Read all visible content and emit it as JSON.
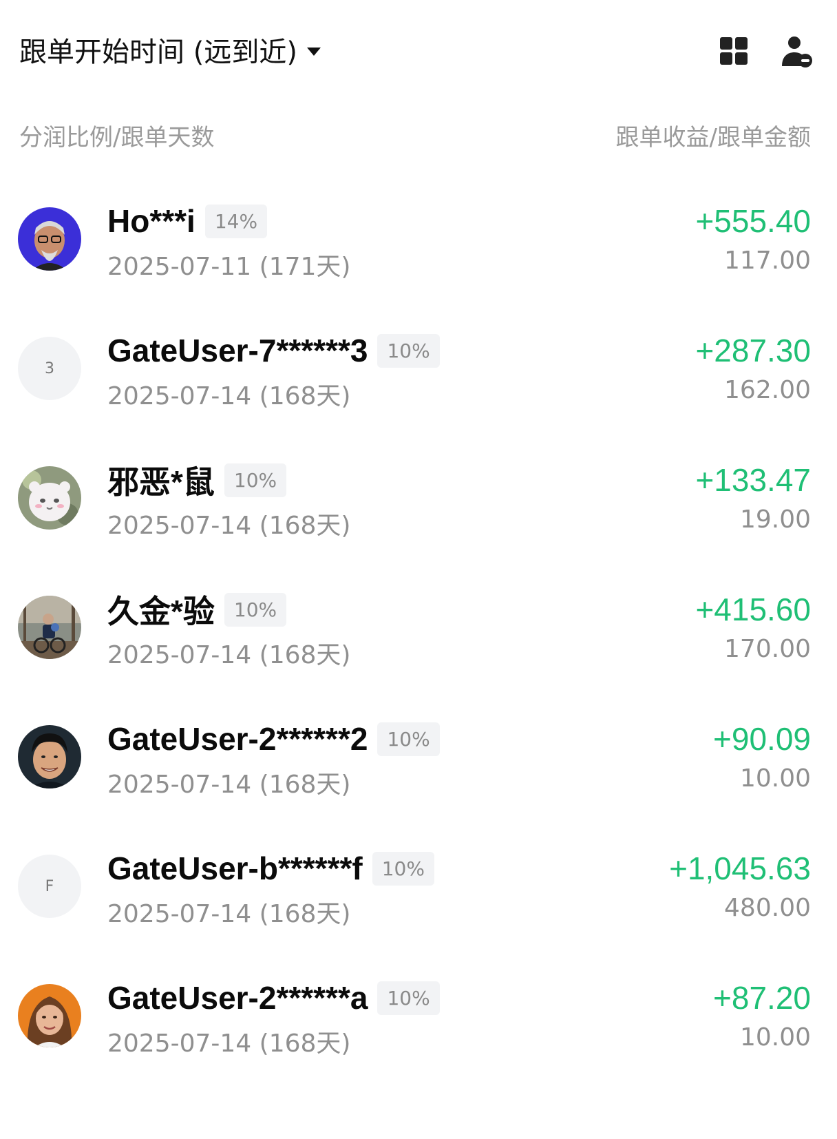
{
  "header": {
    "sort_label": "跟单开始时间 (远到近)",
    "sort_icon": "caret-down-icon",
    "grid_icon": "grid-icon",
    "user_icon": "user-minus-icon"
  },
  "columns": {
    "left": "分润比例/跟单天数",
    "right": "跟单收益/跟单金额"
  },
  "colors": {
    "profit": "#1fbf75",
    "muted": "#8f8f8f",
    "badge_bg": "#f2f3f5"
  },
  "rows": [
    {
      "name": "Ho***i",
      "share": "14%",
      "date": "2025-07-11 (171天)",
      "profit": "+555.40",
      "amount": "117.00",
      "avatar": "photo"
    },
    {
      "name": "GateUser-7******3",
      "share": "10%",
      "date": "2025-07-14 (168天)",
      "profit": "+287.30",
      "amount": "162.00",
      "avatar": "letter",
      "avatar_letter": "3"
    },
    {
      "name": "邪恶*鼠",
      "share": "10%",
      "date": "2025-07-14 (168天)",
      "profit": "+133.47",
      "amount": "19.00",
      "avatar": "photo"
    },
    {
      "name": "久金*验",
      "share": "10%",
      "date": "2025-07-14 (168天)",
      "profit": "+415.60",
      "amount": "170.00",
      "avatar": "photo"
    },
    {
      "name": "GateUser-2******2",
      "share": "10%",
      "date": "2025-07-14 (168天)",
      "profit": "+90.09",
      "amount": "10.00",
      "avatar": "photo"
    },
    {
      "name": "GateUser-b******f",
      "share": "10%",
      "date": "2025-07-14 (168天)",
      "profit": "+1,045.63",
      "amount": "480.00",
      "avatar": "letter",
      "avatar_letter": "F"
    },
    {
      "name": "GateUser-2******a",
      "share": "10%",
      "date": "2025-07-14 (168天)",
      "profit": "+87.20",
      "amount": "10.00",
      "avatar": "photo"
    }
  ]
}
